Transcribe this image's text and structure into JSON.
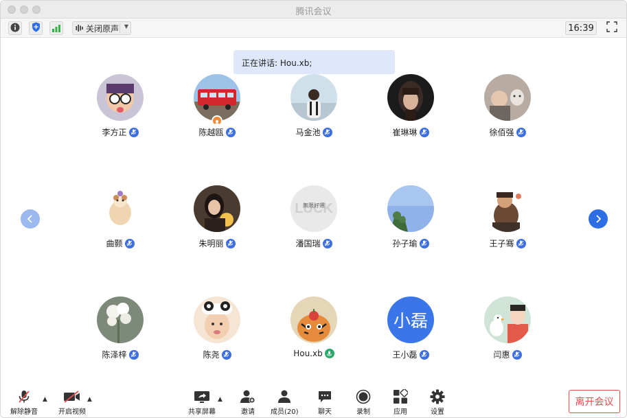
{
  "window": {
    "title": "腾讯会议"
  },
  "toolbar": {
    "audio_label": "关闭原声",
    "clock": "16:39"
  },
  "banner": {
    "speaking": "正在讲话: Hou.xb;"
  },
  "participants": [
    {
      "name": "李方正",
      "mic": "muted"
    },
    {
      "name": "陈越瓯",
      "mic": "muted",
      "host": true
    },
    {
      "name": "马金池",
      "mic": "muted"
    },
    {
      "name": "崔琳琳",
      "mic": "muted"
    },
    {
      "name": "徐佰强",
      "mic": "muted"
    },
    {
      "name": "曲颢",
      "mic": "muted"
    },
    {
      "name": "朱明丽",
      "mic": "muted"
    },
    {
      "name": "潘国瑞",
      "mic": "muted"
    },
    {
      "name": "孙子瑜",
      "mic": "muted"
    },
    {
      "name": "王子骞",
      "mic": "muted"
    },
    {
      "name": "陈泽梓",
      "mic": "muted"
    },
    {
      "name": "陈尧",
      "mic": "muted"
    },
    {
      "name": "Hou.xb",
      "mic": "speaking"
    },
    {
      "name": "王小磊",
      "mic": "muted",
      "avatar_text": "小磊"
    },
    {
      "name": "闫惠",
      "mic": "muted"
    }
  ],
  "avatar_art": {
    "p3": {
      "text": "LUCK",
      "subtext": "無限好運"
    }
  },
  "bottom": {
    "unmute": "解除静音",
    "start_video": "开启视频",
    "share_screen": "共享屏幕",
    "invite": "邀请",
    "members": "成员(20)",
    "chat": "聊天",
    "record": "录制",
    "apps": "应用",
    "settings": "设置",
    "leave": "离开会议"
  },
  "colors": {
    "accent": "#2d6ee6",
    "mic": "#3d6fe0",
    "leave": "#e04e4e",
    "banner": "#dfe8fb"
  }
}
